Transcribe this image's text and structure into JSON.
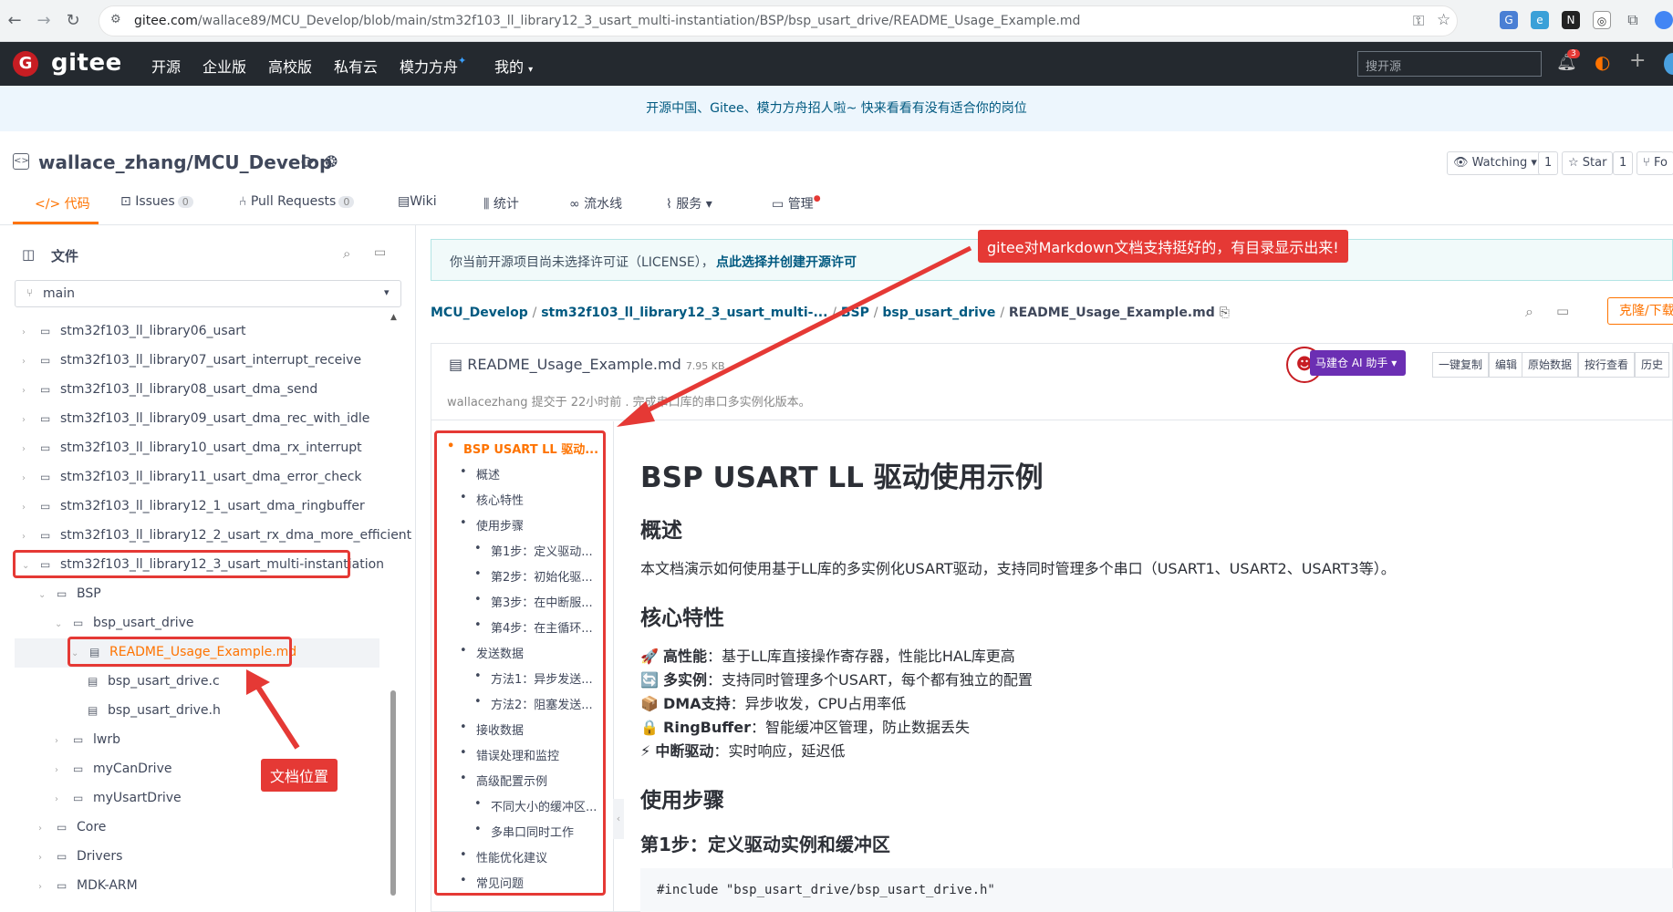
{
  "browser": {
    "url_host": "gitee.com",
    "url_path": "/wallace89/MCU_Develop/blob/main/stm32f103_ll_library12_3_usart_multi-instantiation/BSP/bsp_usart_drive/README_Usage_Example.md"
  },
  "header": {
    "logo_text": "gitee",
    "nav": [
      "开源",
      "企业版",
      "高校版",
      "私有云",
      "模力方舟",
      "我的"
    ],
    "search_placeholder": "搜开源",
    "notification_count": "3"
  },
  "promo_text": "开源中国、Gitee、模力方舟招人啦~ 快来看看有没有适合你的岗位",
  "repo": {
    "title": "wallace_zhang/MCU_Develop",
    "watching_label": "Watching",
    "watching_count": "1",
    "star_label": "Star",
    "star_count": "1",
    "fork_label": "Fo"
  },
  "tabs": [
    {
      "label": "代码",
      "count": ""
    },
    {
      "label": "Issues",
      "count": "0"
    },
    {
      "label": "Pull Requests",
      "count": "0"
    },
    {
      "label": "Wiki",
      "count": ""
    },
    {
      "label": "统计",
      "count": ""
    },
    {
      "label": "流水线",
      "count": ""
    },
    {
      "label": "服务",
      "count": ""
    },
    {
      "label": "管理",
      "count": ""
    }
  ],
  "sidebar": {
    "title": "文件",
    "branch": "main",
    "items": [
      "stm32f103_ll_library06_usart",
      "stm32f103_ll_library07_usart_interrupt_receive",
      "stm32f103_ll_library08_usart_dma_send",
      "stm32f103_ll_library09_usart_dma_rec_with_idle",
      "stm32f103_ll_library10_usart_dma_rx_interrupt",
      "stm32f103_ll_library11_usart_dma_error_check",
      "stm32f103_ll_library12_1_usart_dma_ringbuffer",
      "stm32f103_ll_library12_2_usart_rx_dma_more_efficient",
      "stm32f103_ll_library12_3_usart_multi-instantiation",
      "BSP",
      "bsp_usart_drive",
      "README_Usage_Example.md",
      "bsp_usart_drive.c",
      "bsp_usart_drive.h",
      "lwrb",
      "myCanDrive",
      "myUsartDrive",
      "Core",
      "Drivers",
      "MDK-ARM"
    ]
  },
  "license_notice": {
    "text": "你当前开源项目尚未选择许可证（LICENSE），",
    "link": "点此选择并创建开源许可"
  },
  "breadcrumb": [
    "MCU_Develop",
    "stm32f103_ll_library12_3_usart_multi-...",
    "BSP",
    "bsp_usart_drive",
    "README_Usage_Example.md"
  ],
  "clone_label": "克隆/下载",
  "file": {
    "name": "README_Usage_Example.md",
    "size": "7.95 KB",
    "commit_info": "wallacezhang 提交于 22小时前 . 完成串口库的串口多实例化版本。",
    "ai_button": "马建仓 AI 助手",
    "toolbar": [
      "一键复制",
      "编辑",
      "原始数据",
      "按行查看",
      "历史"
    ]
  },
  "annotations": {
    "callout_top": "gitee对Markdown文档支持挺好的，有目录显示出来!",
    "callout_bottom": "文档位置"
  },
  "toc": [
    "BSP USART LL 驱动...",
    "概述",
    "核心特性",
    "使用步骤",
    "第1步：定义驱动...",
    "第2步：初始化驱...",
    "第3步：在中断服...",
    "第4步：在主循环...",
    "发送数据",
    "方法1：异步发送...",
    "方法2：阻塞发送...",
    "接收数据",
    "错误处理和监控",
    "高级配置示例",
    "不同大小的缓冲区...",
    "多串口同时工作",
    "性能优化建议",
    "常见问题"
  ],
  "markdown": {
    "h1": "BSP USART LL 驱动使用示例",
    "overview_h": "概述",
    "overview_p": "本文档演示如何使用基于LL库的多实例化USART驱动，支持同时管理多个串口（USART1、USART2、USART3等）。",
    "features_h": "核心特性",
    "features": [
      {
        "icon": "🚀",
        "bold": "高性能",
        "text": "：基于LL库直接操作寄存器，性能比HAL库更高"
      },
      {
        "icon": "🔄",
        "bold": "多实例",
        "text": "：支持同时管理多个USART，每个都有独立的配置"
      },
      {
        "icon": "📦",
        "bold": "DMA支持",
        "text": "：异步收发，CPU占用率低"
      },
      {
        "icon": "🔒",
        "bold": "RingBuffer",
        "text": "：智能缓冲区管理，防止数据丢失"
      },
      {
        "icon": "⚡",
        "bold": "中断驱动",
        "text": "：实时响应，延迟低"
      }
    ],
    "usage_h": "使用步骤",
    "step1_h": "第1步：定义驱动实例和缓冲区",
    "code_line": "#include \"bsp_usart_drive/bsp_usart_drive.h\""
  }
}
